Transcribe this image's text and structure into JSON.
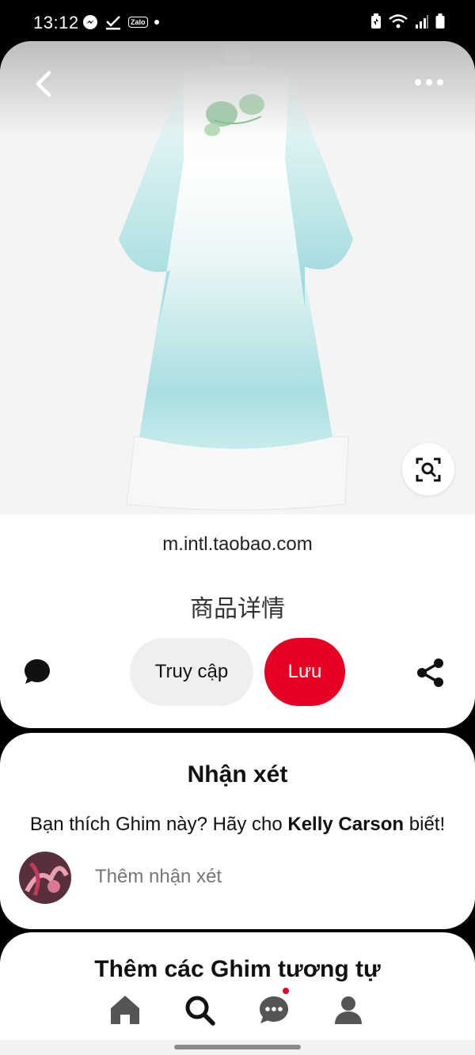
{
  "status_bar": {
    "time": "13:12",
    "icons_left": [
      "messenger-icon",
      "download-check-icon",
      "zalo-icon",
      "dot-icon"
    ],
    "zalo_label": "Zalo",
    "icons_right": [
      "battery-saver-icon",
      "wifi-icon",
      "signal-icon",
      "battery-icon"
    ]
  },
  "pin": {
    "domain": "m.intl.taobao.com",
    "title": "商品详情",
    "visit_label": "Truy cập",
    "save_label": "Lưu"
  },
  "comments": {
    "heading": "Nhận xét",
    "prompt_prefix": "Bạn thích Ghim này? Hãy cho ",
    "author": "Kelly Carson",
    "prompt_suffix": " biết!",
    "add_placeholder": "Thêm nhận xét"
  },
  "similar": {
    "heading": "Thêm các Ghim tương tự"
  },
  "nav": {
    "items": [
      "home-icon",
      "search-icon",
      "messages-icon",
      "profile-icon"
    ],
    "has_notification_on": "messages"
  },
  "colors": {
    "accent": "#e60023",
    "dress_teal": "#a8dde0"
  }
}
